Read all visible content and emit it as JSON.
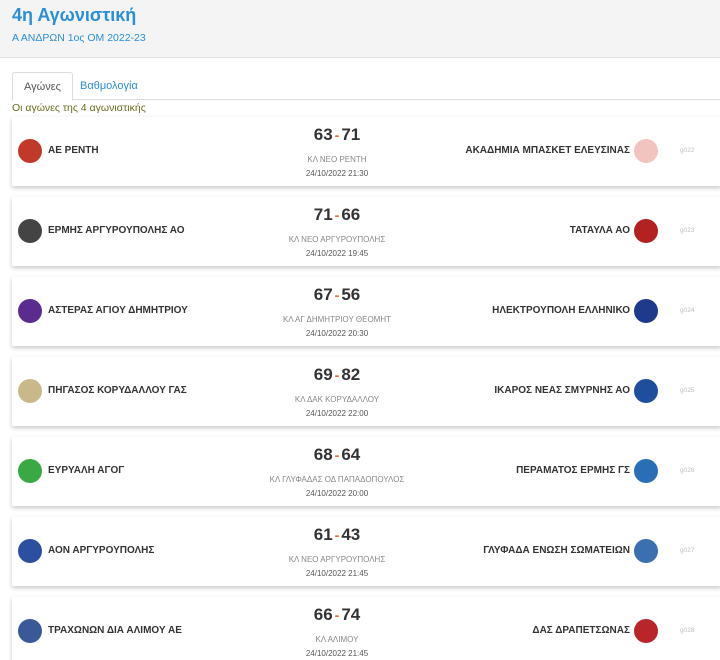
{
  "header": {
    "title": "4η Αγωνιστική",
    "subtitle": "Α ΑΝΔΡΩΝ 1ος ΟΜ 2022-23"
  },
  "tabs": [
    {
      "label": "Αγώνες"
    },
    {
      "label": "Βαθμολογία"
    }
  ],
  "caption": "Οι αγώνες της 4 αγωνιστικής",
  "matches": [
    {
      "home": "ΑΕ ΡΕΝΤΗ",
      "away": "ΑΚΑΔΗΜΙΑ ΜΠΑΣΚΕΤ ΕΛΕΥΣΙΝΑΣ",
      "home_score": "63",
      "away_score": "71",
      "venue": "ΚΛ ΝΕΟ ΡΕΝΤΗ",
      "datetime": "24/10/2022 21:30",
      "code": "g022"
    },
    {
      "home": "ΕΡΜΗΣ ΑΡΓΥΡΟΥΠΟΛΗΣ ΑΟ",
      "away": "ΤΑΤΑΥΛΑ ΑΟ",
      "home_score": "71",
      "away_score": "66",
      "venue": "ΚΛ ΝΕΟ ΑΡΓΥΡΟΥΠΟΛΗΣ",
      "datetime": "24/10/2022 19:45",
      "code": "g023"
    },
    {
      "home": "ΑΣΤΕΡΑΣ ΑΓΙΟΥ ΔΗΜΗΤΡΙΟΥ",
      "away": "ΗΛΕΚΤΡΟΥΠΟΛΗ ΕΛΛΗΝΙΚΟ",
      "home_score": "67",
      "away_score": "56",
      "venue": "ΚΛ ΑΓ ΔΗΜΗΤΡΙΟΥ ΘΕΟΜΗΤ",
      "datetime": "24/10/2022 20:30",
      "code": "g024"
    },
    {
      "home": "ΠΗΓΑΣΟΣ ΚΟΡΥΔΑΛΛΟΥ ΓΑΣ",
      "away": "ΙΚΑΡΟΣ ΝΕΑΣ ΣΜΥΡΝΗΣ ΑΟ",
      "home_score": "69",
      "away_score": "82",
      "venue": "ΚΛ ΔΑΚ ΚΟΡΥΔΑΛΛΟΥ",
      "datetime": "24/10/2022 22:00",
      "code": "g025"
    },
    {
      "home": "ΕΥΡΥΑΛΗ ΑΓΟΓ",
      "away": "ΠΕΡΑΜΑΤΟΣ ΕΡΜΗΣ ΓΣ",
      "home_score": "68",
      "away_score": "64",
      "venue": "ΚΛ ΓΛΥΦΑΔΑΣ ΟΔ ΠΑΠΑΔΟΠΟΥΛΟΣ",
      "datetime": "24/10/2022 20:00",
      "code": "g026"
    },
    {
      "home": "ΑΟΝ ΑΡΓΥΡΟΥΠΟΛΗΣ",
      "away": "ΓΛΥΦΑΔΑ ΕΝΩΣΗ ΣΩΜΑΤΕΙΩΝ",
      "home_score": "61",
      "away_score": "43",
      "venue": "ΚΛ ΝΕΟ ΑΡΓΥΡΟΥΠΟΛΗΣ",
      "datetime": "24/10/2022 21:45",
      "code": "g027"
    },
    {
      "home": "ΤΡΑΧΩΝΩΝ ΔΙΑ ΑΛΙΜΟΥ ΑΕ",
      "away": "ΔΑΣ ΔΡΑΠΕΤΣΩΝΑΣ",
      "home_score": "66",
      "away_score": "74",
      "venue": "ΚΛ ΑΛΙΜΟΥ",
      "datetime": "24/10/2022 21:45",
      "code": "g028"
    }
  ],
  "logo_colors": [
    {
      "home": "#c0392b",
      "away": "#f2c4c0"
    },
    {
      "home": "#444444",
      "away": "#b22222"
    },
    {
      "home": "#5b2c8f",
      "away": "#1f3a8a"
    },
    {
      "home": "#c9b98a",
      "away": "#1f4e9c"
    },
    {
      "home": "#3aa845",
      "away": "#2a6fb6"
    },
    {
      "home": "#2c4fa0",
      "away": "#3b6fb0"
    },
    {
      "home": "#3b5998",
      "away": "#b8252b"
    }
  ]
}
